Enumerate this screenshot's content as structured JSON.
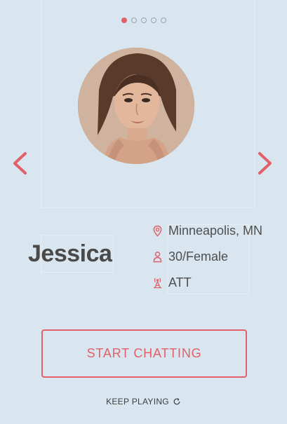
{
  "carousel": {
    "dot_count": 5,
    "active_index": 0
  },
  "profile": {
    "name": "Jessica",
    "location": "Minneapolis, MN",
    "age_gender": "30/Female",
    "carrier": "ATT"
  },
  "actions": {
    "start_label": "START CHATTING",
    "keep_playing_label": "KEEP PLAYING"
  },
  "icons": {
    "prev": "chevron-left-icon",
    "next": "chevron-right-icon",
    "location": "map-pin-icon",
    "person": "person-icon",
    "carrier": "radio-tower-icon",
    "refresh": "refresh-icon"
  },
  "colors": {
    "background": "#d9e6ef",
    "accent": "#e0616a",
    "text": "#4a4a4a"
  }
}
